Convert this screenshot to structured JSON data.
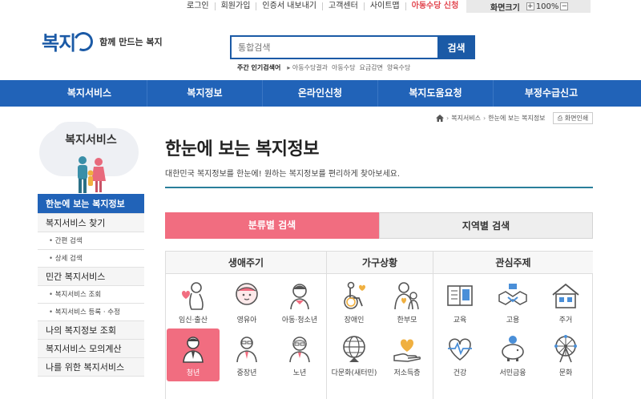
{
  "util": {
    "links": [
      "로그인",
      "회원가입",
      "인증서 내보내기",
      "고객센터",
      "사이트맵",
      "아동수당 신청"
    ],
    "zoom_label": "화면크기",
    "zoom_plus": "+",
    "zoom_value": "100%",
    "zoom_minus": "−"
  },
  "header": {
    "logo_text": "복지",
    "slogan": "함께 만드는 복지",
    "search_placeholder": "통합검색",
    "search_button": "검색",
    "popular_label": "주간 인기검색어",
    "popular_keywords": [
      "▸ 아동수당결과",
      "아동수당",
      "요금감면",
      "양육수당"
    ]
  },
  "gnb": [
    "복지서비스",
    "복지정보",
    "온라인신청",
    "복지도움요청",
    "부정수급신고"
  ],
  "breadcrumb": [
    "복지서비스",
    "한눈에 보는 복지정보"
  ],
  "print_label": "화면인쇄",
  "sidebar": {
    "title": "복지서비스",
    "items": [
      {
        "label": "한눈에 보는 복지정보",
        "type": "active"
      },
      {
        "label": "복지서비스 찾기",
        "type": "main"
      },
      {
        "label": "간편 검색",
        "type": "sub"
      },
      {
        "label": "상세 검색",
        "type": "sub"
      },
      {
        "label": "민간 복지서비스",
        "type": "main"
      },
      {
        "label": "복지서비스 조회",
        "type": "sub"
      },
      {
        "label": "복지서비스 등록 · 수정",
        "type": "sub"
      },
      {
        "label": "나의 복지정보 조회",
        "type": "main"
      },
      {
        "label": "복지서비스 모의계산",
        "type": "main"
      },
      {
        "label": "나를 위한 복지서비스",
        "type": "main"
      }
    ]
  },
  "content": {
    "title": "한눈에 보는 복지정보",
    "desc": "대한민국 복지정보를 한눈에! 원하는 복지정보를 편리하게 찾아보세요.",
    "tabs": [
      "분류별 검색",
      "지역별 검색"
    ],
    "columns": [
      "생애주기",
      "가구상황",
      "관심주제"
    ]
  },
  "categories": {
    "life": [
      "임신·출산",
      "영유아",
      "아동·청소년",
      "청년",
      "중장년",
      "노년"
    ],
    "household": [
      "장애인",
      "한부모",
      "다문화(새터민)",
      "저소득층"
    ],
    "interest": [
      "교육",
      "고용",
      "주거",
      "건강",
      "서민금융",
      "문화"
    ]
  },
  "colors": {
    "primary": "#2163b8",
    "accent": "#f16d80",
    "alert": "#e2464f"
  }
}
